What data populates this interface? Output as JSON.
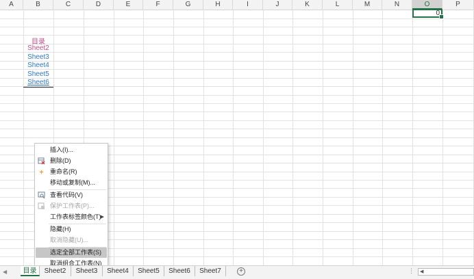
{
  "columns": [
    "A",
    "B",
    "C",
    "D",
    "E",
    "F",
    "G",
    "H",
    "I",
    "J",
    "K",
    "L",
    "M",
    "N",
    "O",
    "P"
  ],
  "selected_column": "O",
  "active_cell_value": "0",
  "toc": {
    "title": "目录",
    "links": [
      "Sheet2",
      "Sheet3",
      "Sheet4",
      "Sheet5",
      "Sheet6"
    ]
  },
  "context_menu": {
    "items": [
      {
        "label": "插入(I)...",
        "icon": "",
        "disabled": false
      },
      {
        "label": "删除(D)",
        "icon": "delete-sheet-icon",
        "disabled": false
      },
      {
        "label": "重命名(R)",
        "icon": "rename-icon",
        "disabled": false
      },
      {
        "label": "移动或复制(M)...",
        "icon": "",
        "disabled": false
      },
      {
        "label": "查看代码(V)",
        "icon": "view-code-icon",
        "disabled": false
      },
      {
        "label": "保护工作表(P)...",
        "icon": "protect-sheet-icon",
        "disabled": true
      },
      {
        "label": "工作表标签颜色(T)",
        "icon": "",
        "disabled": false,
        "submenu": true
      },
      {
        "label": "隐藏(H)",
        "icon": "",
        "disabled": false
      },
      {
        "label": "取消隐藏(U)...",
        "icon": "",
        "disabled": true
      },
      {
        "label": "选定全部工作表(S)",
        "icon": "",
        "disabled": false,
        "highlighted": true
      },
      {
        "label": "取消组合工作表(N)",
        "icon": "",
        "disabled": false
      }
    ]
  },
  "sheet_tabs": [
    {
      "label": "目录",
      "active": true
    },
    {
      "label": "Sheet2",
      "active": false
    },
    {
      "label": "Sheet3",
      "active": false
    },
    {
      "label": "Sheet4",
      "active": false
    },
    {
      "label": "Sheet5",
      "active": false
    },
    {
      "label": "Sheet6",
      "active": false
    },
    {
      "label": "Sheet7",
      "active": false
    }
  ],
  "colors": {
    "accent": "#217346",
    "toc_title": "#c0508a",
    "link": "#2e76c8"
  }
}
